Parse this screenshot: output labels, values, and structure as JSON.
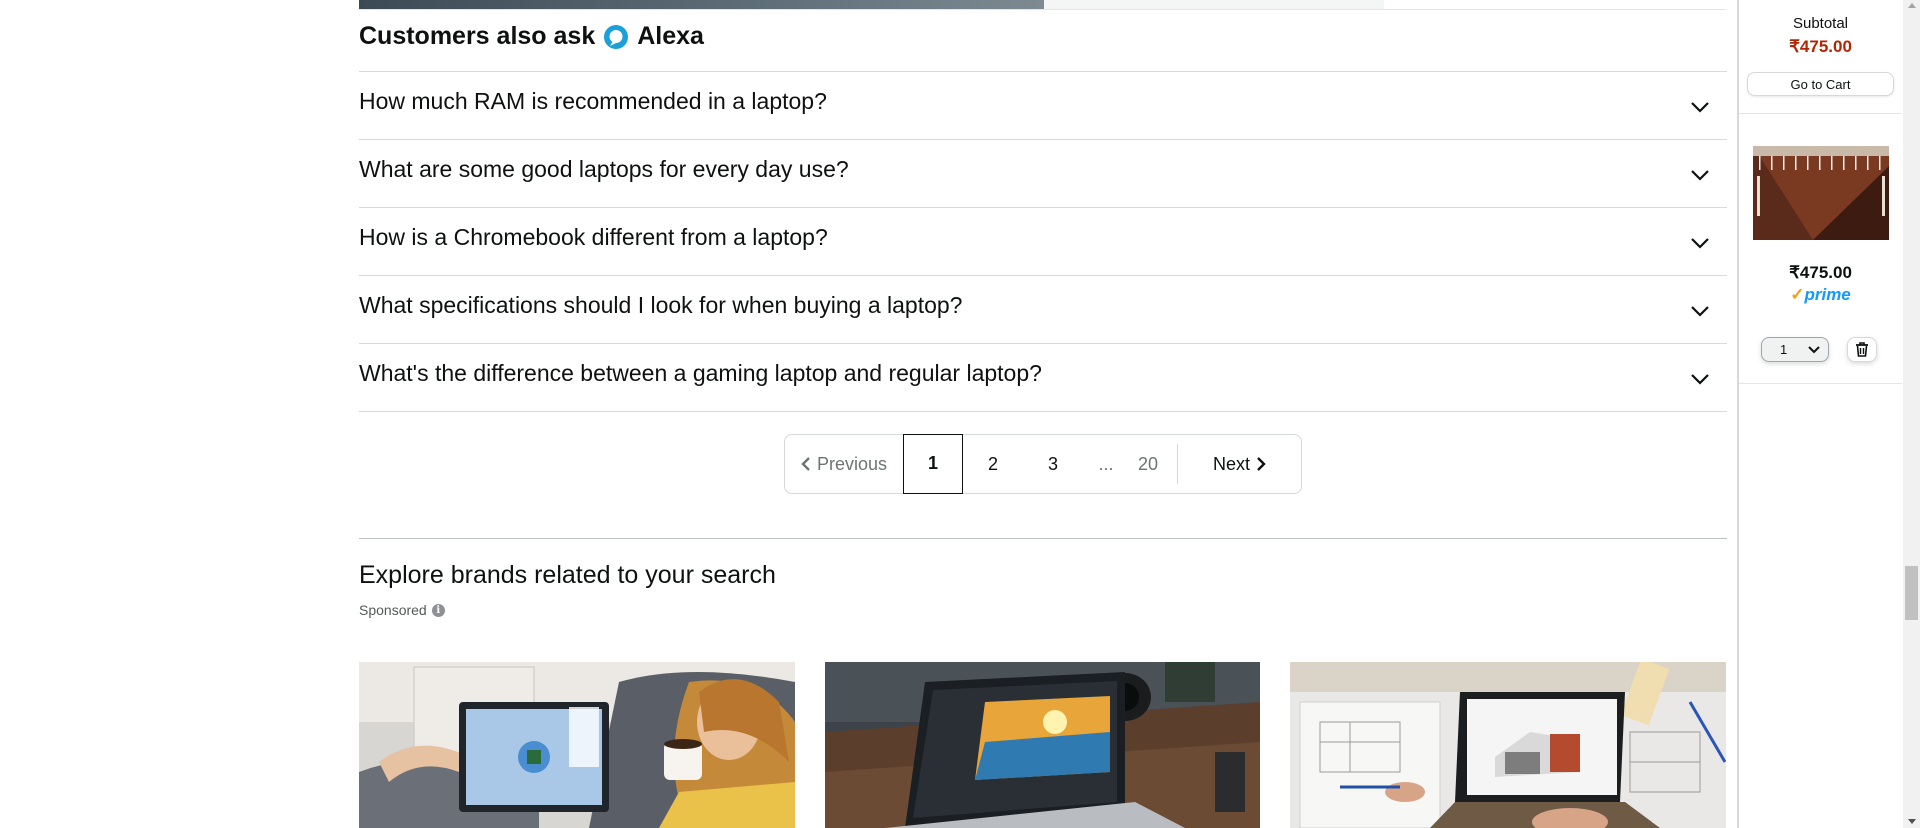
{
  "alexa_section": {
    "title_prefix": "Customers also ask",
    "title_suffix": "Alexa",
    "questions": [
      "How much RAM is recommended in a laptop?",
      "What are some good laptops for every day use?",
      "How is a Chromebook different from a laptop?",
      "What specifications should I look for when buying a laptop?",
      "What's the difference between a gaming laptop and regular laptop?"
    ],
    "expand_icon": "chevron-down-icon",
    "logo_icon": "alexa-ring-icon",
    "logo_color": "#1ba0d8"
  },
  "pagination": {
    "previous": "Previous",
    "current": "1",
    "pages": [
      "2",
      "3"
    ],
    "ellipsis": "...",
    "last": "20",
    "next": "Next"
  },
  "brands": {
    "title": "Explore brands related to your search",
    "sponsored": "Sponsored",
    "info_icon": "i",
    "cards": [
      "laptop-on-couch-image",
      "laptop-photo-editing-image",
      "laptop-architecture-image"
    ]
  },
  "cart": {
    "subtotal_label": "Subtotal",
    "subtotal_value": "₹475.00",
    "go_to_cart": "Go to Cart",
    "item_price": "₹475.00",
    "prime_check": "✓",
    "prime_label": "prime",
    "quantity": "1",
    "delete_icon": "trash-icon",
    "price_color": "#b12704",
    "prime_color": "#1399ff"
  }
}
